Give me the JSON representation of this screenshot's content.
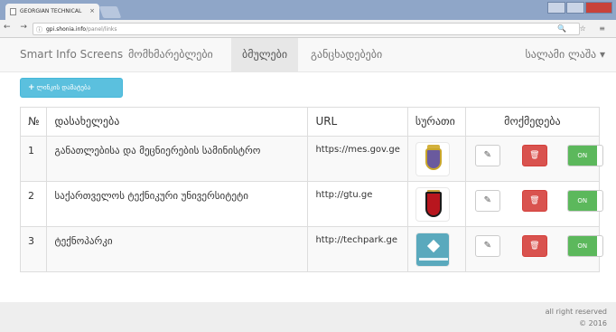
{
  "browser": {
    "tab_title": "GEORGIAN TECHNICAL",
    "tab_close": "×",
    "url_info": "ⓘ",
    "url_host": "gpi.shonia.info",
    "url_path": "/panel/links",
    "nav_arrows": "← → C",
    "addr_icons": "🔍 ☆ ≡"
  },
  "navbar": {
    "brand": "Smart Info Screens",
    "items": [
      {
        "label": "მომხმარებლები"
      },
      {
        "label": "ბმულები"
      },
      {
        "label": "განცხადებები"
      }
    ],
    "active_index": 1,
    "user": "სალამი ლაშა ▾"
  },
  "add_button": {
    "plus": "+",
    "label": "ლინკის დამატება"
  },
  "table": {
    "headers": {
      "num": "№",
      "name": "დასახელება",
      "url": "URL",
      "image": "სურათი",
      "actions": "მოქმედება"
    },
    "rows": [
      {
        "num": "1",
        "name": "განათლებისა და მეცნიერების სამინისტრო",
        "url": "https://mes.gov.ge",
        "toggle": "ON"
      },
      {
        "num": "2",
        "name": "საქართველოს ტექნიკური უნივერსიტეტი",
        "url": "http://gtu.ge",
        "toggle": "ON"
      },
      {
        "num": "3",
        "name": "ტექნოპარკი",
        "url": "http://techpark.ge",
        "toggle": "ON"
      }
    ],
    "icons": {
      "edit": "✎",
      "delete": "🗑"
    }
  },
  "footer": {
    "line1": "all right reserved",
    "line2": "© 2016"
  },
  "colors": {
    "info": "#5bc0de",
    "danger": "#d9534f",
    "success": "#5cb85c"
  }
}
